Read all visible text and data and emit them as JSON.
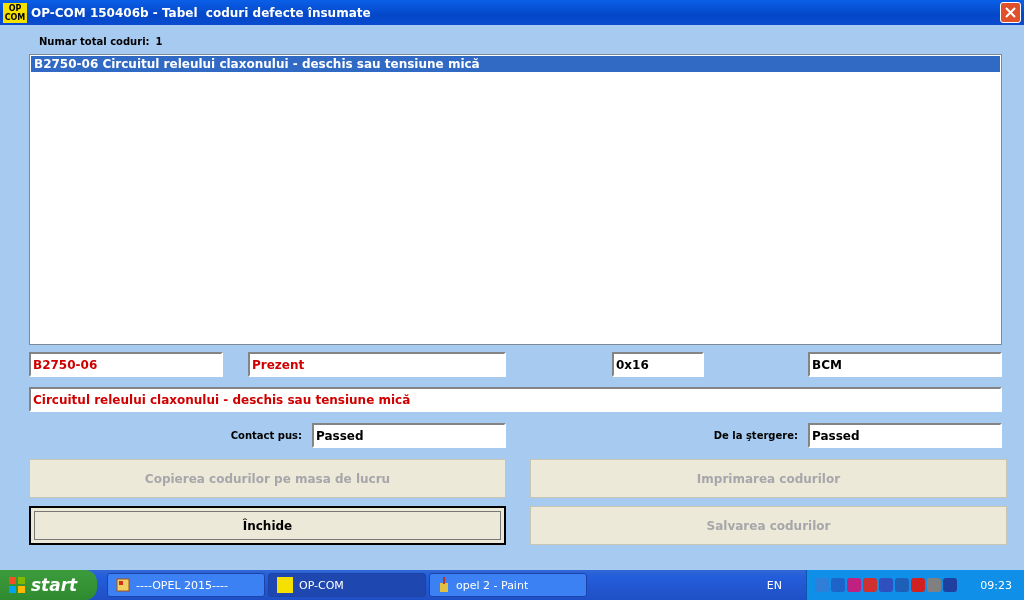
{
  "window": {
    "title": "OP-COM 150406b - Tabel  coduri defecte însumate",
    "app_icon": [
      "OP",
      "COM"
    ]
  },
  "total": {
    "label": "Numar total coduri:",
    "value": "1"
  },
  "codes": [
    {
      "text": "B2750-06 Circuitul releului claxonului - deschis sau tensiune mică",
      "selected": true
    }
  ],
  "detail": {
    "code": "B2750-06",
    "status": "Prezent",
    "address": "0x16",
    "module": "BCM",
    "description": "Circuitul releului claxonului - deschis sau tensiune mică",
    "contact_label": "Contact pus:",
    "contact_value": "Passed",
    "clear_label": "De la ştergere:",
    "clear_value": "Passed"
  },
  "buttons": [
    {
      "label": "Copierea codurilor pe masa de lucru",
      "disabled": true,
      "focused": false
    },
    {
      "label": "Imprimarea codurilor",
      "disabled": true,
      "focused": false
    },
    {
      "label": "Închide",
      "disabled": false,
      "focused": true
    },
    {
      "label": "Salvarea codurilor",
      "disabled": true,
      "focused": false
    }
  ],
  "taskbar": {
    "start": "start",
    "tasks": [
      {
        "label": "----OPEL 2015----",
        "kind": "window",
        "selected": false
      },
      {
        "label": "OP-COM",
        "kind": "opcom",
        "selected": true
      },
      {
        "label": "opel 2 - Paint",
        "kind": "paint",
        "selected": false
      }
    ],
    "language": "EN",
    "clock": "09:23"
  }
}
